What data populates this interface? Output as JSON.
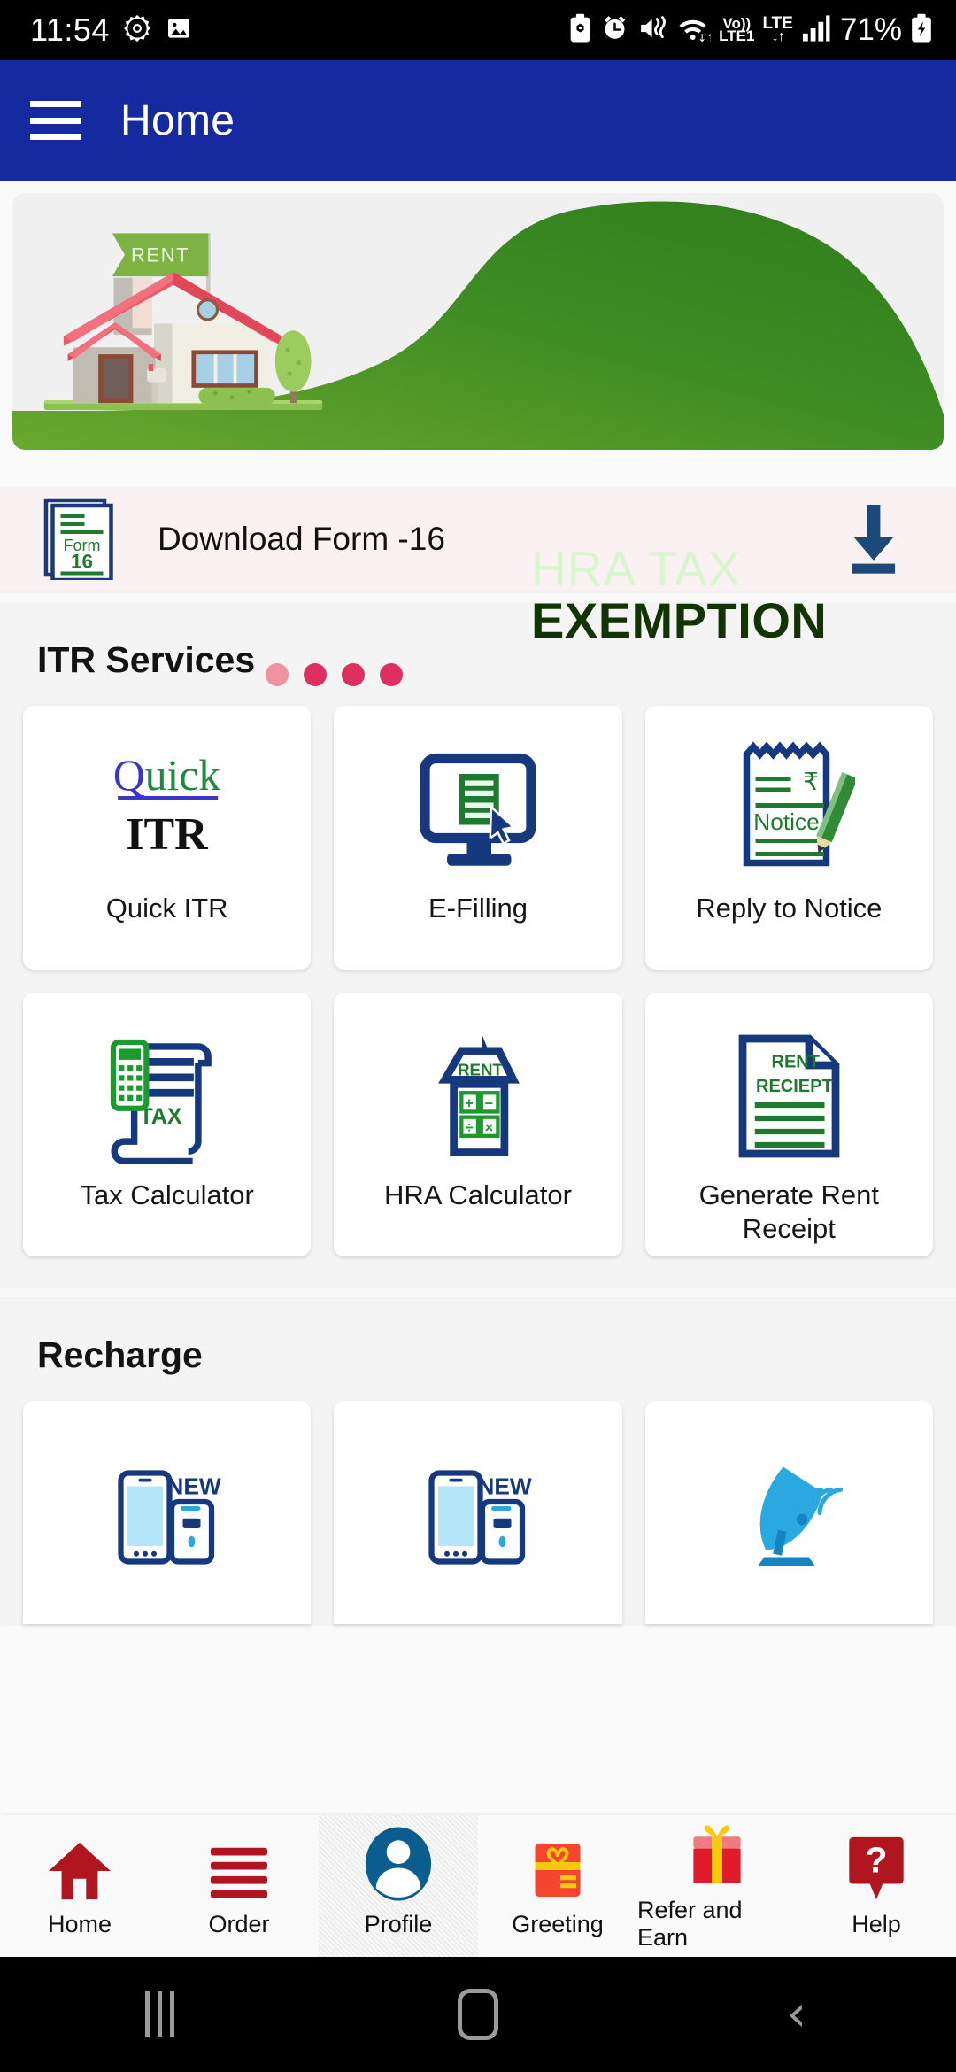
{
  "status_bar": {
    "time": "11:54",
    "left_icons": [
      "settings-gear-icon",
      "gallery-image-icon"
    ],
    "right_icons": [
      "battery-saver-icon",
      "alarm-icon",
      "vibrate-mute-icon",
      "wifi-icon",
      "volte-icon",
      "lte-data-icon",
      "signal-bars-icon"
    ],
    "volte_label": "Vo))",
    "volte_sub": "LTE1",
    "lte_label": "LTE",
    "lte_arrows": "↓↑",
    "battery_percent": "71%"
  },
  "app_bar": {
    "menu_icon": "hamburger-menu-icon",
    "title": "Home"
  },
  "banner": {
    "flag_label": "RENT",
    "headline_line1": "HRA TAX",
    "headline_line2": "EXEMPTION",
    "green_color": "#3d8c22",
    "dot_active_color": "#f0929f",
    "dot_color": "#dd3060",
    "dots_count": 4,
    "active_dot_index": 0
  },
  "download_form": {
    "icon": "form-16-document-icon",
    "icon_text_top": "Form",
    "icon_text_bottom": "16",
    "label": "Download Form -16",
    "download_icon": "download-arrow-icon"
  },
  "itr_services": {
    "title": "ITR Services",
    "items": [
      {
        "label": "Quick ITR",
        "icon": "quick-itr-logo-icon",
        "logo_word1": "Quick",
        "logo_word2": "ITR"
      },
      {
        "label": "E-Filling",
        "icon": "monitor-document-cursor-icon"
      },
      {
        "label": "Reply to Notice",
        "icon": "notice-pad-pencil-icon",
        "icon_text": "Notice"
      },
      {
        "label": "Tax Calculator",
        "icon": "calculator-scroll-icon",
        "icon_text": "TAX"
      },
      {
        "label": "HRA Calculator",
        "icon": "house-calculator-icon",
        "icon_text": "RENT"
      },
      {
        "label": "Generate Rent Receipt",
        "icon": "rent-receipt-document-icon",
        "icon_text_1": "RENT",
        "icon_text_2": "RECIEPT"
      }
    ]
  },
  "recharge": {
    "title": "Recharge",
    "items": [
      {
        "icon": "mobile-prepaid-new-icon",
        "badge": "NEW"
      },
      {
        "icon": "mobile-postpaid-new-icon",
        "badge": "NEW"
      },
      {
        "icon": "dth-satellite-dish-icon"
      }
    ]
  },
  "bottom_nav": {
    "selected_index": 2,
    "items": [
      {
        "label": "Home",
        "icon": "home-icon"
      },
      {
        "label": "Order",
        "icon": "order-list-icon"
      },
      {
        "label": "Profile",
        "icon": "profile-avatar-icon"
      },
      {
        "label": "Greeting",
        "icon": "greeting-card-icon"
      },
      {
        "label": "Refer and Earn",
        "icon": "gift-box-icon"
      },
      {
        "label": "Help",
        "icon": "help-question-icon"
      }
    ]
  },
  "android_nav": {
    "recents": "recents-icon",
    "home": "home-pill-icon",
    "back": "back-chevron-icon",
    "back_glyph": "‹"
  }
}
